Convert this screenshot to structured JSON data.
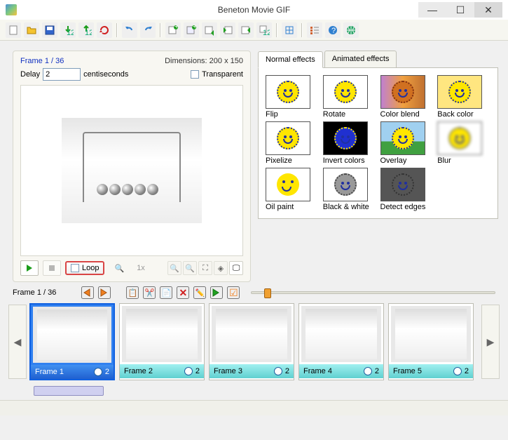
{
  "app": {
    "title": "Beneton Movie GIF"
  },
  "toolbar": {
    "icons": [
      "new-file-icon",
      "open-folder-icon",
      "save-icon",
      "import-icon",
      "export-icon",
      "refresh-icon",
      "sep",
      "undo-icon",
      "redo-icon",
      "sep",
      "add-frame-icon",
      "add-blank-icon",
      "insert-frame-icon",
      "move-left-icon",
      "move-right-icon",
      "renumber-icon",
      "sep",
      "resize-icon",
      "sep",
      "properties-icon",
      "help-icon",
      "web-icon"
    ]
  },
  "preview": {
    "frame_label": "Frame 1 / 36",
    "dimensions_label": "Dimensions: 200 x 150",
    "delay_label": "Delay",
    "delay_value": "2",
    "delay_unit": "centiseconds",
    "transparent_label": "Transparent",
    "loop_label": "Loop",
    "zoom_label": "1x"
  },
  "effects": {
    "tabs": [
      {
        "label": "Normal effects",
        "active": true
      },
      {
        "label": "Animated effects",
        "active": false
      }
    ],
    "items": [
      {
        "name": "Flip",
        "style": "plain"
      },
      {
        "name": "Rotate",
        "style": "plain"
      },
      {
        "name": "Color blend",
        "style": "blend"
      },
      {
        "name": "Back color",
        "style": "back"
      },
      {
        "name": "Pixelize",
        "style": "pixel"
      },
      {
        "name": "Invert colors",
        "style": "invert"
      },
      {
        "name": "Overlay",
        "style": "overlay"
      },
      {
        "name": "Blur",
        "style": "blur"
      },
      {
        "name": "Oil paint",
        "style": "oil"
      },
      {
        "name": "Black & white",
        "style": "bw"
      },
      {
        "name": "Detect edges",
        "style": "edges"
      }
    ]
  },
  "framebar": {
    "label": "Frame 1 / 36"
  },
  "frames": [
    {
      "label": "Frame 1",
      "delay": "2",
      "selected": true
    },
    {
      "label": "Frame 2",
      "delay": "2",
      "selected": false
    },
    {
      "label": "Frame 3",
      "delay": "2",
      "selected": false
    },
    {
      "label": "Frame 4",
      "delay": "2",
      "selected": false
    },
    {
      "label": "Frame 5",
      "delay": "2",
      "selected": false
    }
  ]
}
